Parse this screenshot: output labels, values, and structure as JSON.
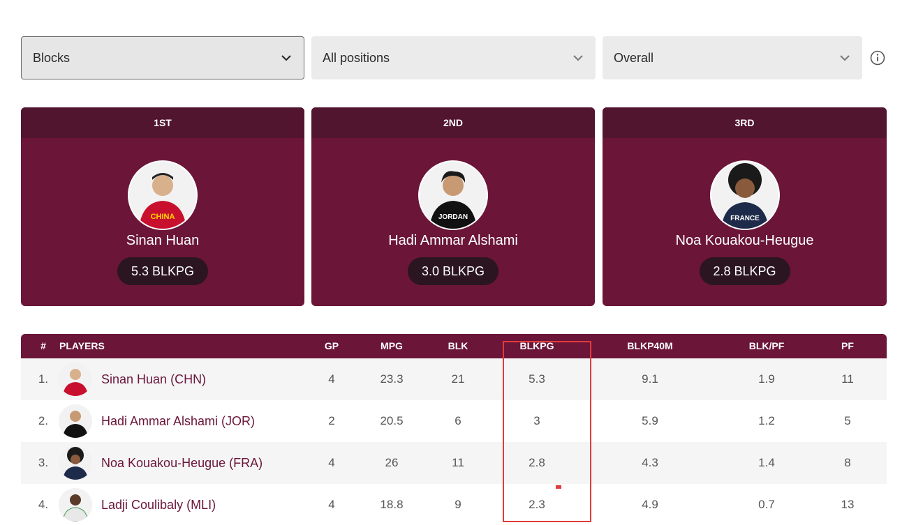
{
  "filters": {
    "stat": "Blocks",
    "position": "All positions",
    "scope": "Overall"
  },
  "podium": [
    {
      "rank": "1ST",
      "name": "Sinan Huan",
      "stat": "5.3 BLKPG",
      "jersey": "CHINA",
      "jersey_color": "#c8102e"
    },
    {
      "rank": "2ND",
      "name": "Hadi Ammar Alshami",
      "stat": "3.0 BLKPG",
      "jersey": "JORDAN",
      "jersey_color": "#111111"
    },
    {
      "rank": "3RD",
      "name": "Noa Kouakou-Heugue",
      "stat": "2.8 BLKPG",
      "jersey": "FRANCE",
      "jersey_color": "#1e2a4a"
    }
  ],
  "table": {
    "headers": {
      "num": "#",
      "players": "PLAYERS",
      "gp": "GP",
      "mpg": "MPG",
      "blk": "BLK",
      "blkpg": "BLKPG",
      "blkp40m": "BLKP40M",
      "blkpf": "BLK/PF",
      "pf": "PF"
    },
    "rows": [
      {
        "num": "1.",
        "player": "Sinan Huan (CHN)",
        "gp": "4",
        "mpg": "23.3",
        "blk": "21",
        "blkpg": "5.3",
        "blkp40m": "9.1",
        "blkpf": "1.9",
        "pf": "11",
        "jersey_color": "#c8102e"
      },
      {
        "num": "2.",
        "player": "Hadi Ammar Alshami (JOR)",
        "gp": "2",
        "mpg": "20.5",
        "blk": "6",
        "blkpg": "3",
        "blkp40m": "5.9",
        "blkpf": "1.2",
        "pf": "5",
        "jersey_color": "#111111"
      },
      {
        "num": "3.",
        "player": "Noa Kouakou-Heugue (FRA)",
        "gp": "4",
        "mpg": "26",
        "blk": "11",
        "blkpg": "2.8",
        "blkp40m": "4.3",
        "blkpf": "1.4",
        "pf": "8",
        "jersey_color": "#1e2a4a"
      },
      {
        "num": "4.",
        "player": "Ladji Coulibaly (MLI)",
        "gp": "4",
        "mpg": "18.8",
        "blk": "9",
        "blkpg": "2.3",
        "blkp40m": "4.9",
        "blkpf": "0.7",
        "pf": "13",
        "jersey_color": "#e8e8e8"
      }
    ]
  },
  "colors": {
    "brand": "#6b1538",
    "brand_dark": "#521530",
    "highlight": "#e23b3b"
  }
}
